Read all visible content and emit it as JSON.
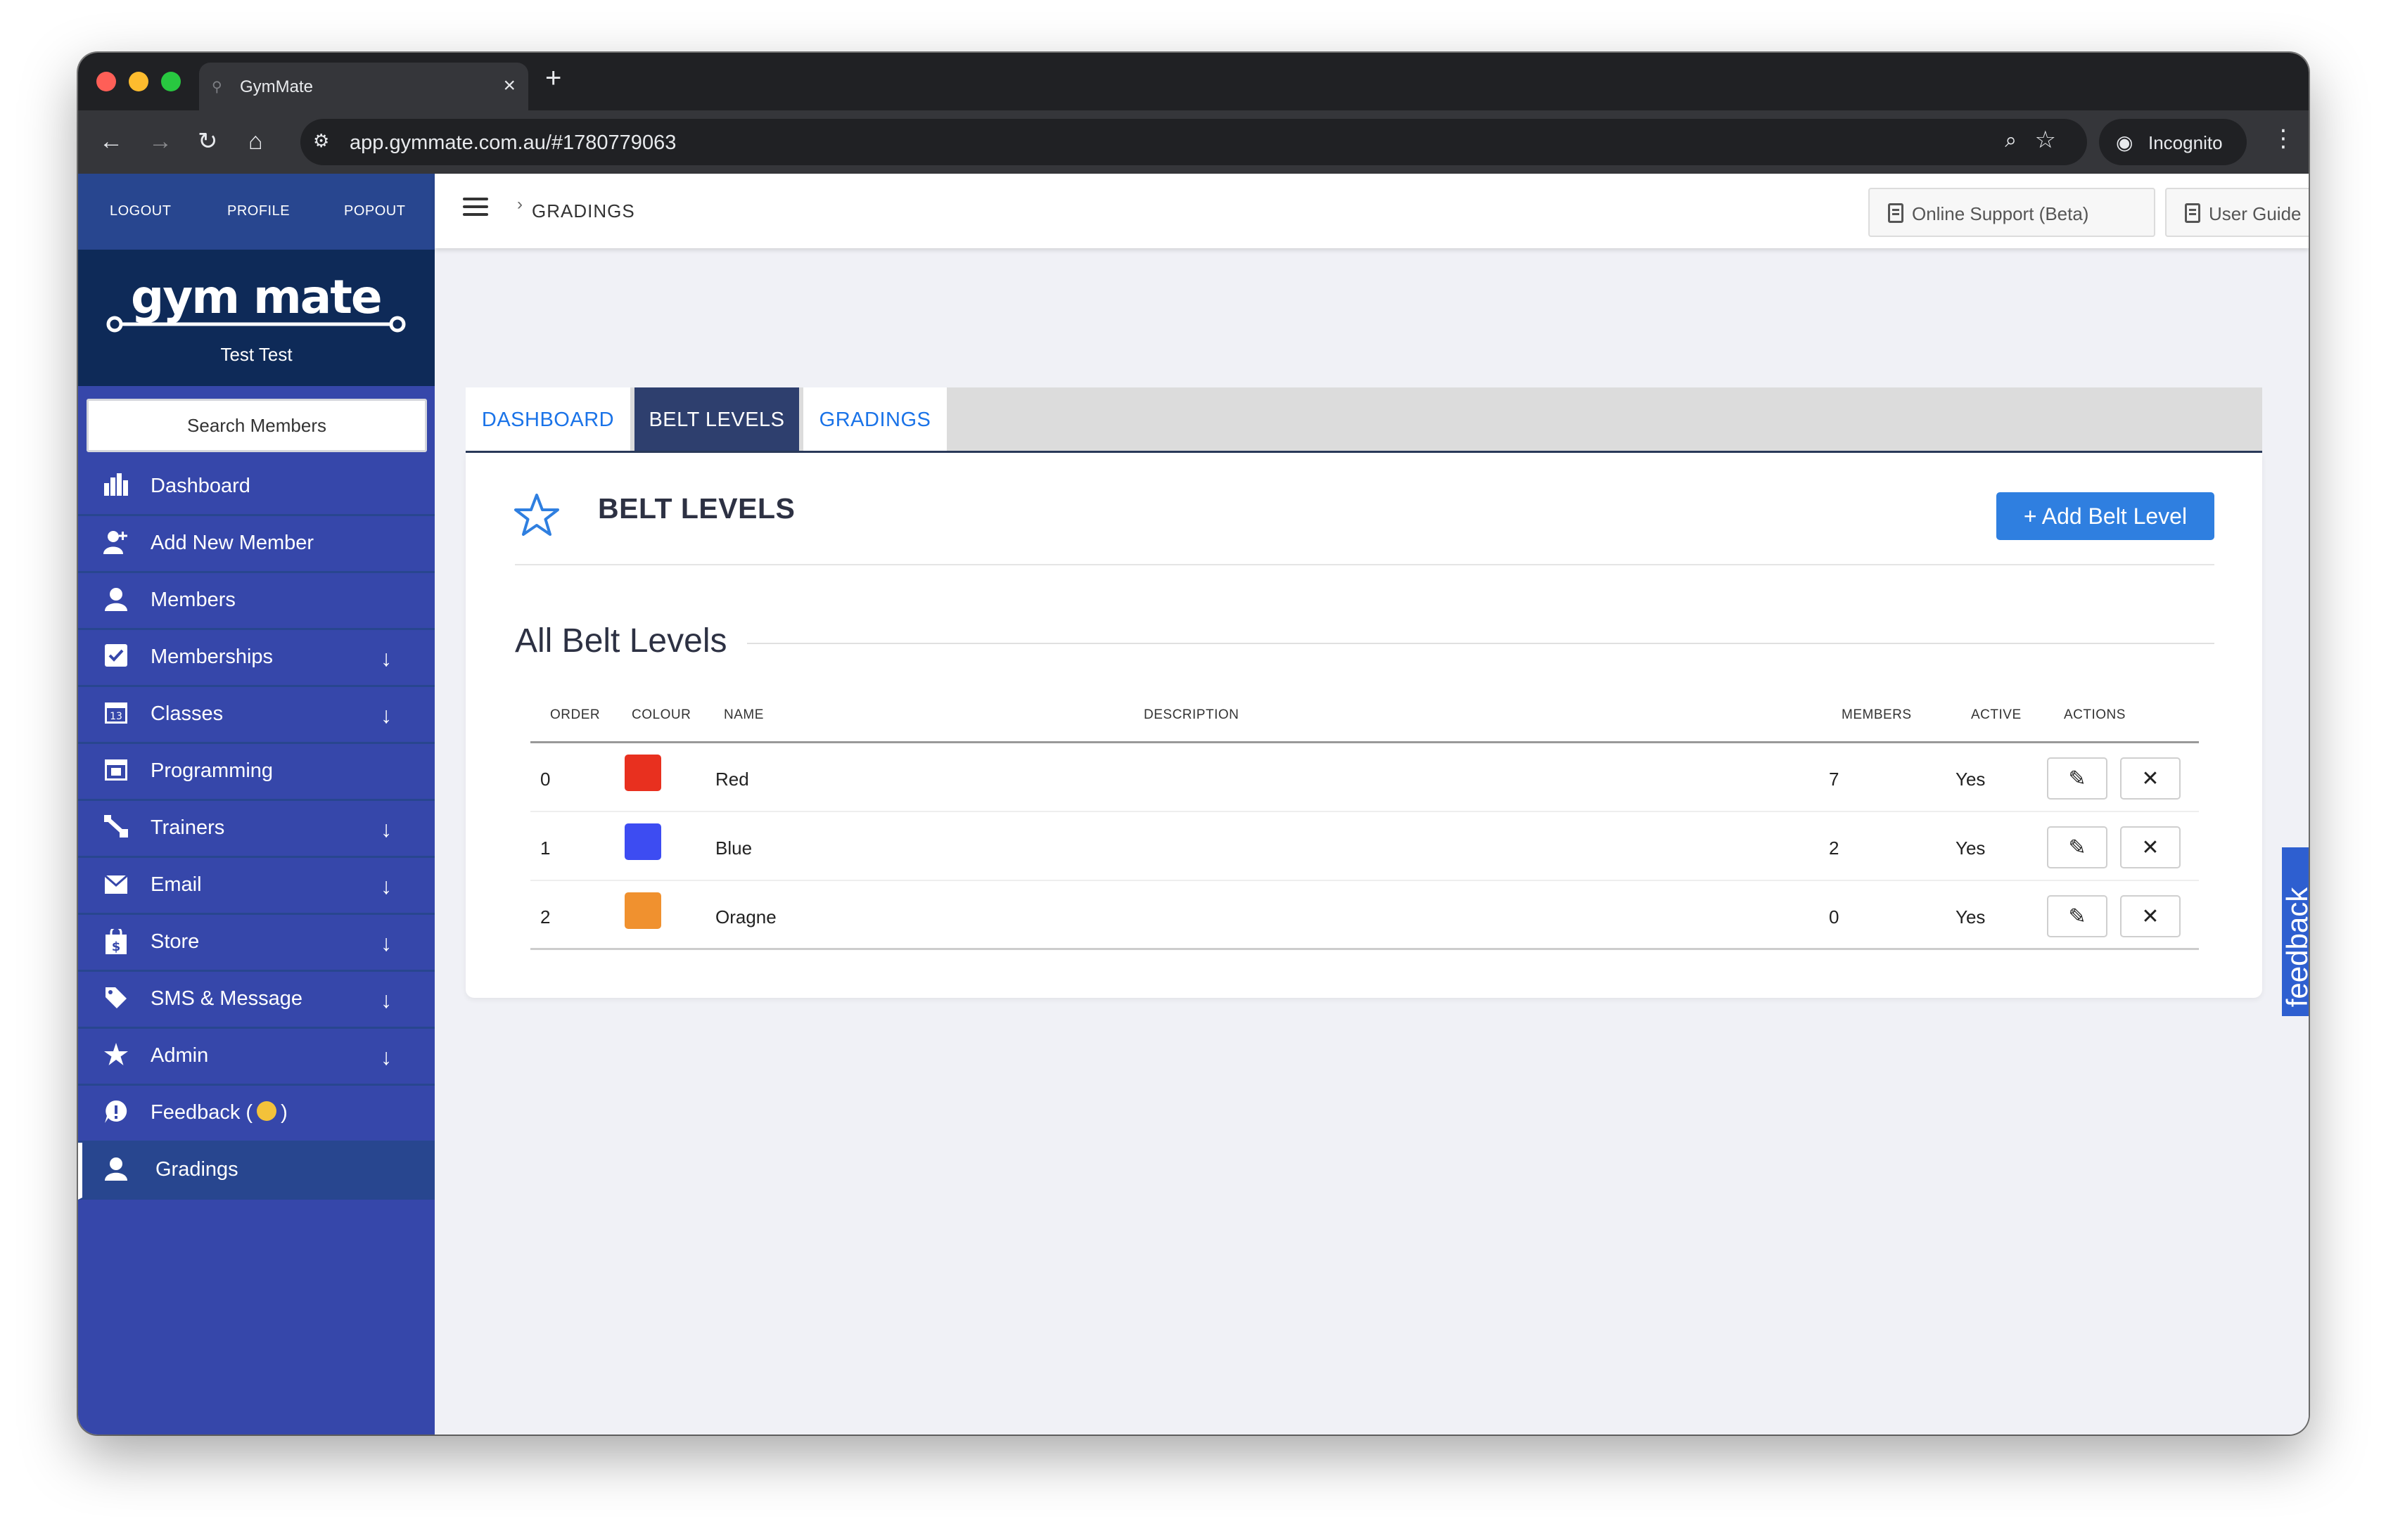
{
  "browser": {
    "tab_title": "GymMate",
    "url": "app.gymmate.com.au/#1780779063",
    "profile_label": "Incognito"
  },
  "sidebar": {
    "top_links": [
      "LOGOUT",
      "PROFILE",
      "POPOUT"
    ],
    "logo_text": "gym mate",
    "user_name": "Test Test",
    "search_label": "Search Members",
    "items": [
      {
        "label": "Dashboard",
        "icon": "bar-chart-icon",
        "expandable": false
      },
      {
        "label": "Add New Member",
        "icon": "add-user-icon",
        "expandable": false
      },
      {
        "label": "Members",
        "icon": "user-icon",
        "expandable": false
      },
      {
        "label": "Memberships",
        "icon": "checkbox-icon",
        "expandable": true
      },
      {
        "label": "Classes",
        "icon": "calendar-icon",
        "expandable": true
      },
      {
        "label": "Programming",
        "icon": "calendar-programming-icon",
        "expandable": false
      },
      {
        "label": "Trainers",
        "icon": "trainer-icon",
        "expandable": true
      },
      {
        "label": "Email",
        "icon": "envelope-icon",
        "expandable": true
      },
      {
        "label": "Store",
        "icon": "shopping-bag-icon",
        "expandable": true
      },
      {
        "label": "SMS & Message",
        "icon": "tag-icon",
        "expandable": true
      },
      {
        "label": "Admin",
        "icon": "star-icon",
        "expandable": true
      },
      {
        "label": "Feedback (",
        "label_suffix": ")",
        "icon": "feedback-icon",
        "expandable": false
      },
      {
        "label": "Gradings",
        "icon": "user-icon",
        "expandable": false,
        "active": true
      }
    ]
  },
  "header": {
    "breadcrumb": "GRADINGS",
    "online_support_label": "Online Support (Beta)",
    "user_guide_label": "User Guide"
  },
  "tabs": [
    {
      "label": "DASHBOARD",
      "active": false
    },
    {
      "label": "BELT LEVELS",
      "active": true
    },
    {
      "label": "GRADINGS",
      "active": false
    }
  ],
  "card": {
    "title": "BELT LEVELS",
    "add_button_label": "+ Add Belt Level",
    "section_title": "All Belt Levels"
  },
  "table": {
    "columns": [
      "ORDER",
      "COLOUR",
      "NAME",
      "DESCRIPTION",
      "MEMBERS",
      "ACTIVE",
      "ACTIONS"
    ],
    "rows": [
      {
        "order": "0",
        "colour": "#e8301f",
        "name": "Red",
        "description": "",
        "members": "7",
        "active": "Yes"
      },
      {
        "order": "1",
        "colour": "#3d4cf2",
        "name": "Blue",
        "description": "",
        "members": "2",
        "active": "Yes"
      },
      {
        "order": "2",
        "colour": "#f0912f",
        "name": "Oragne",
        "description": "",
        "members": "0",
        "active": "Yes"
      }
    ]
  },
  "feedback_tab_label": "feedback",
  "colors": {
    "sidebar_bg": "#3647aa",
    "sidebar_dark": "#28468f",
    "logo_bg": "#0e2a58",
    "accent_blue": "#2f7fe0",
    "active_tab": "#2e3f6e"
  }
}
